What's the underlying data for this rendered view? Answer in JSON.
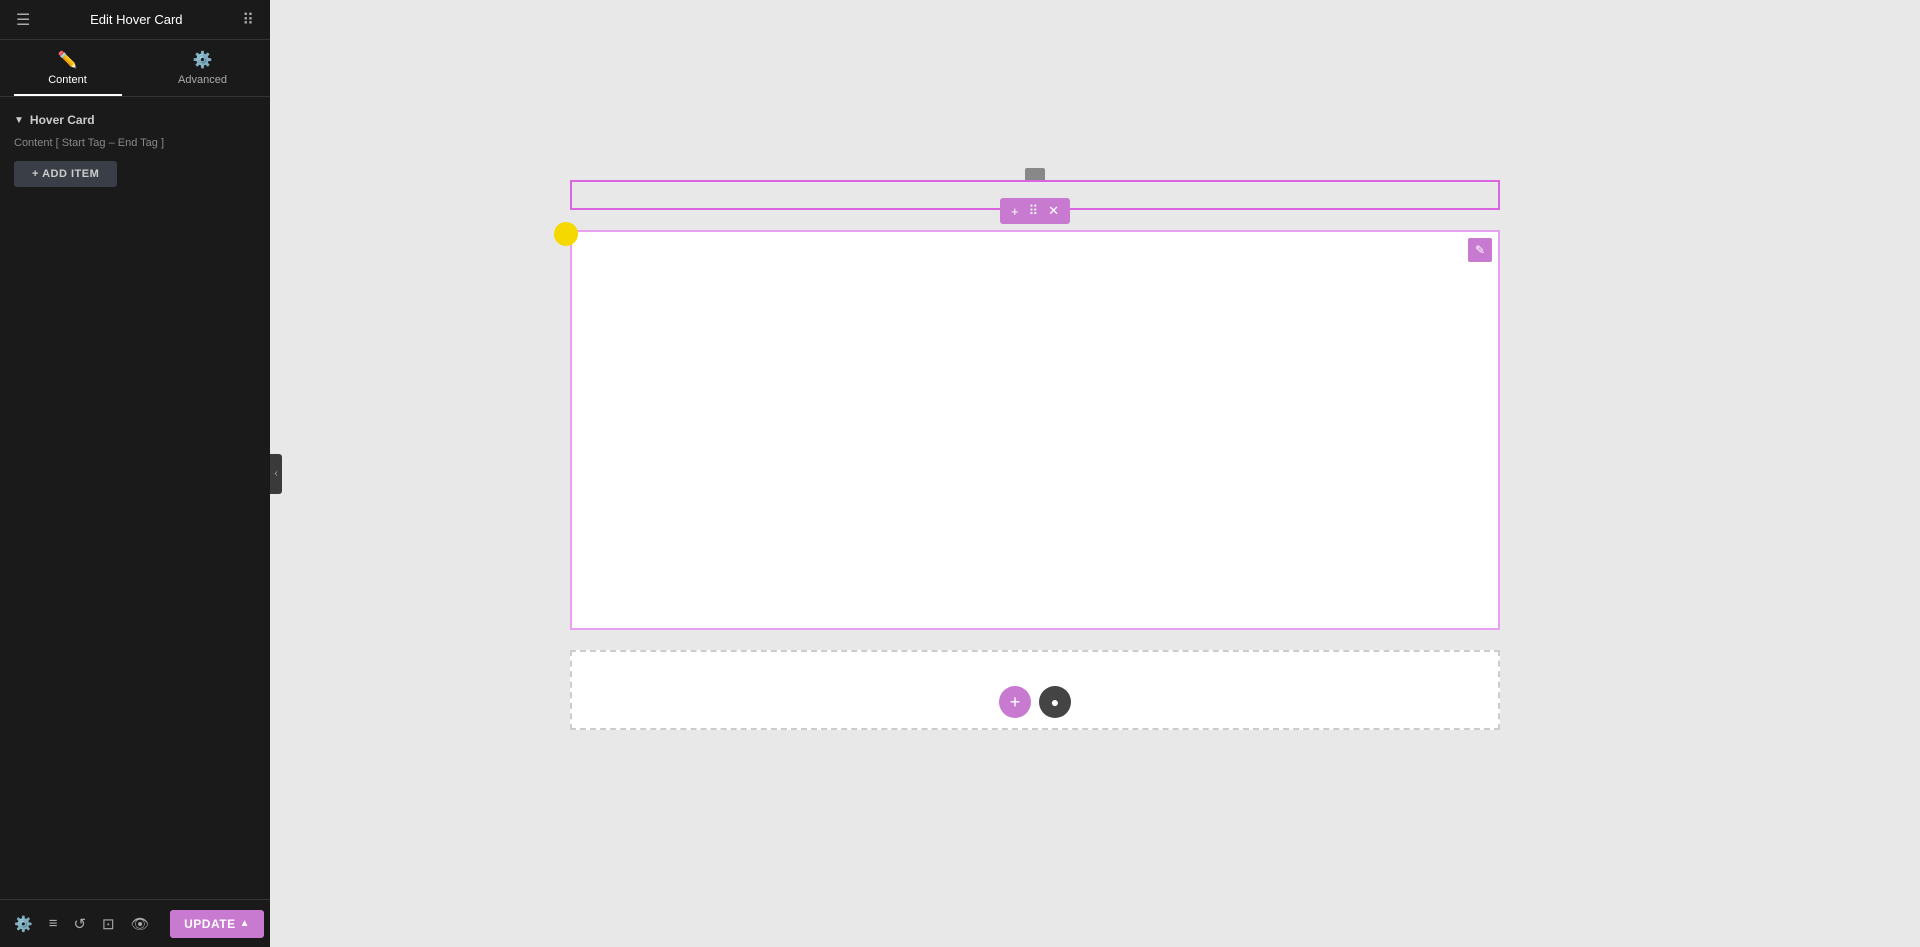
{
  "sidebar": {
    "title": "Edit Hover Card",
    "tabs": [
      {
        "id": "content",
        "label": "Content",
        "icon": "✏️",
        "active": true
      },
      {
        "id": "advanced",
        "label": "Advanced",
        "icon": "⚙️",
        "active": false
      }
    ],
    "section": {
      "title": "Hover Card",
      "content_label": "Content [ Start Tag – End Tag ]"
    },
    "add_item_label": "+ ADD ITEM",
    "footer": {
      "update_label": "UPDATE",
      "chevron": "▲"
    }
  },
  "toolbar": {
    "add_icon": "+",
    "drag_icon": "⠿",
    "close_icon": "✕"
  },
  "canvas": {
    "edit_icon": "✎"
  }
}
